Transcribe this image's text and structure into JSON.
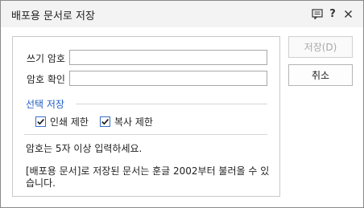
{
  "dialog": {
    "title": "배포용 문서로 저장",
    "icons": [
      "help-chat-icon",
      "question-icon",
      "close-icon"
    ]
  },
  "form": {
    "password_label": "쓰기 암호",
    "password_value": "",
    "confirm_label": "암호 확인",
    "confirm_value": "",
    "section_title": "선택 저장",
    "checkbox_print_label": "인쇄 제한",
    "checkbox_print_checked": true,
    "checkbox_copy_label": "복사 제한",
    "checkbox_copy_checked": true,
    "info_line1": "암호는 5자 이상 입력하세요.",
    "info_line2": "[배포용 문서]로 저장된 문서는 훈글 2002부터 불러올 수 있",
    "info_line3": "습니다."
  },
  "buttons": {
    "save_label": "저장(D)",
    "save_enabled": false,
    "cancel_label": "취소"
  },
  "colors": {
    "section_accent": "#1f5fc4",
    "checkbox_border": "#3a6fc7",
    "titlebar_bg": "#f3f3f3"
  }
}
